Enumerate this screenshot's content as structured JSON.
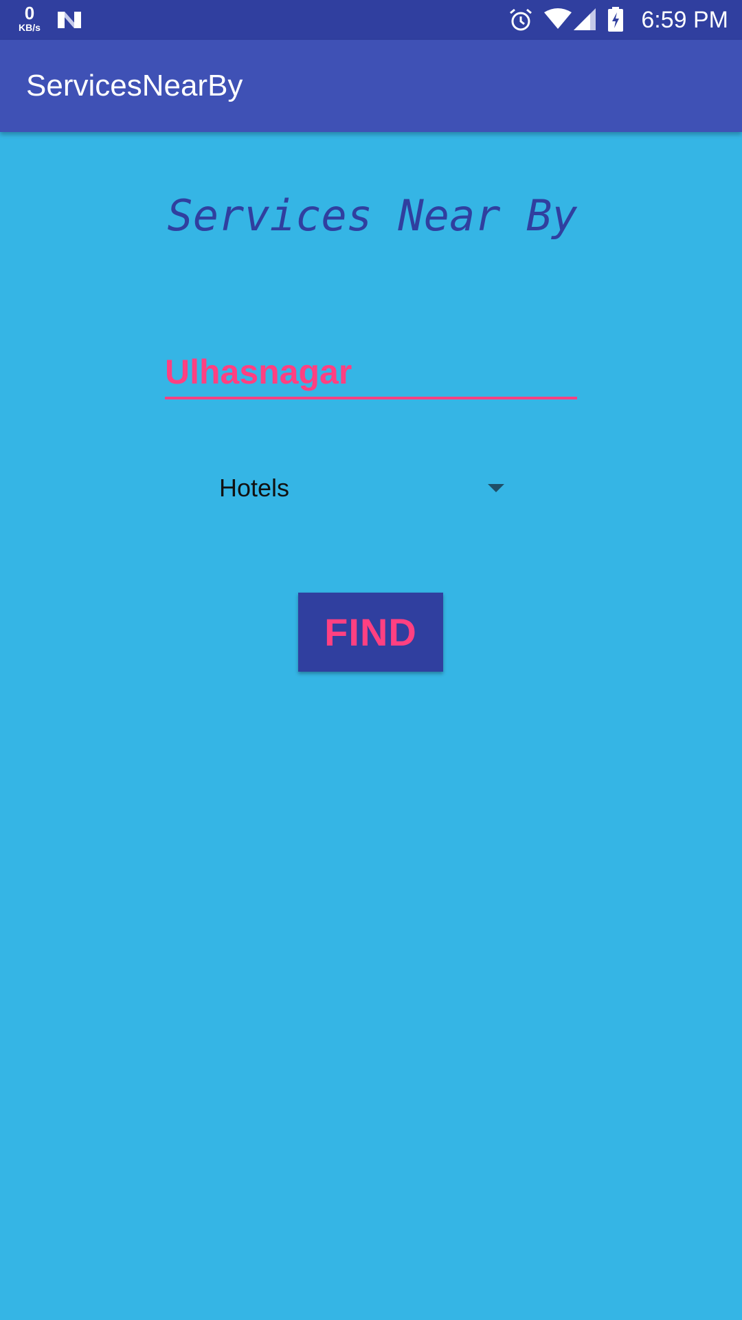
{
  "status_bar": {
    "net_speed_value": "0",
    "net_speed_unit": "KB/s",
    "time": "6:59 PM",
    "icons": [
      "n-notification-icon",
      "alarm-icon",
      "wifi-icon",
      "cell-signal-icon",
      "battery-charging-icon"
    ]
  },
  "app_bar": {
    "title": "ServicesNearBy"
  },
  "main": {
    "heading": "Services Near By",
    "city_input": {
      "value": "Ulhasnagar"
    },
    "category_spinner": {
      "selected": "Hotels"
    },
    "find_button_label": "FIND"
  },
  "colors": {
    "status_bar": "#303f9f",
    "app_bar": "#3f51b5",
    "background": "#35b5e5",
    "accent": "#ff4081",
    "heading": "#303f9f"
  }
}
